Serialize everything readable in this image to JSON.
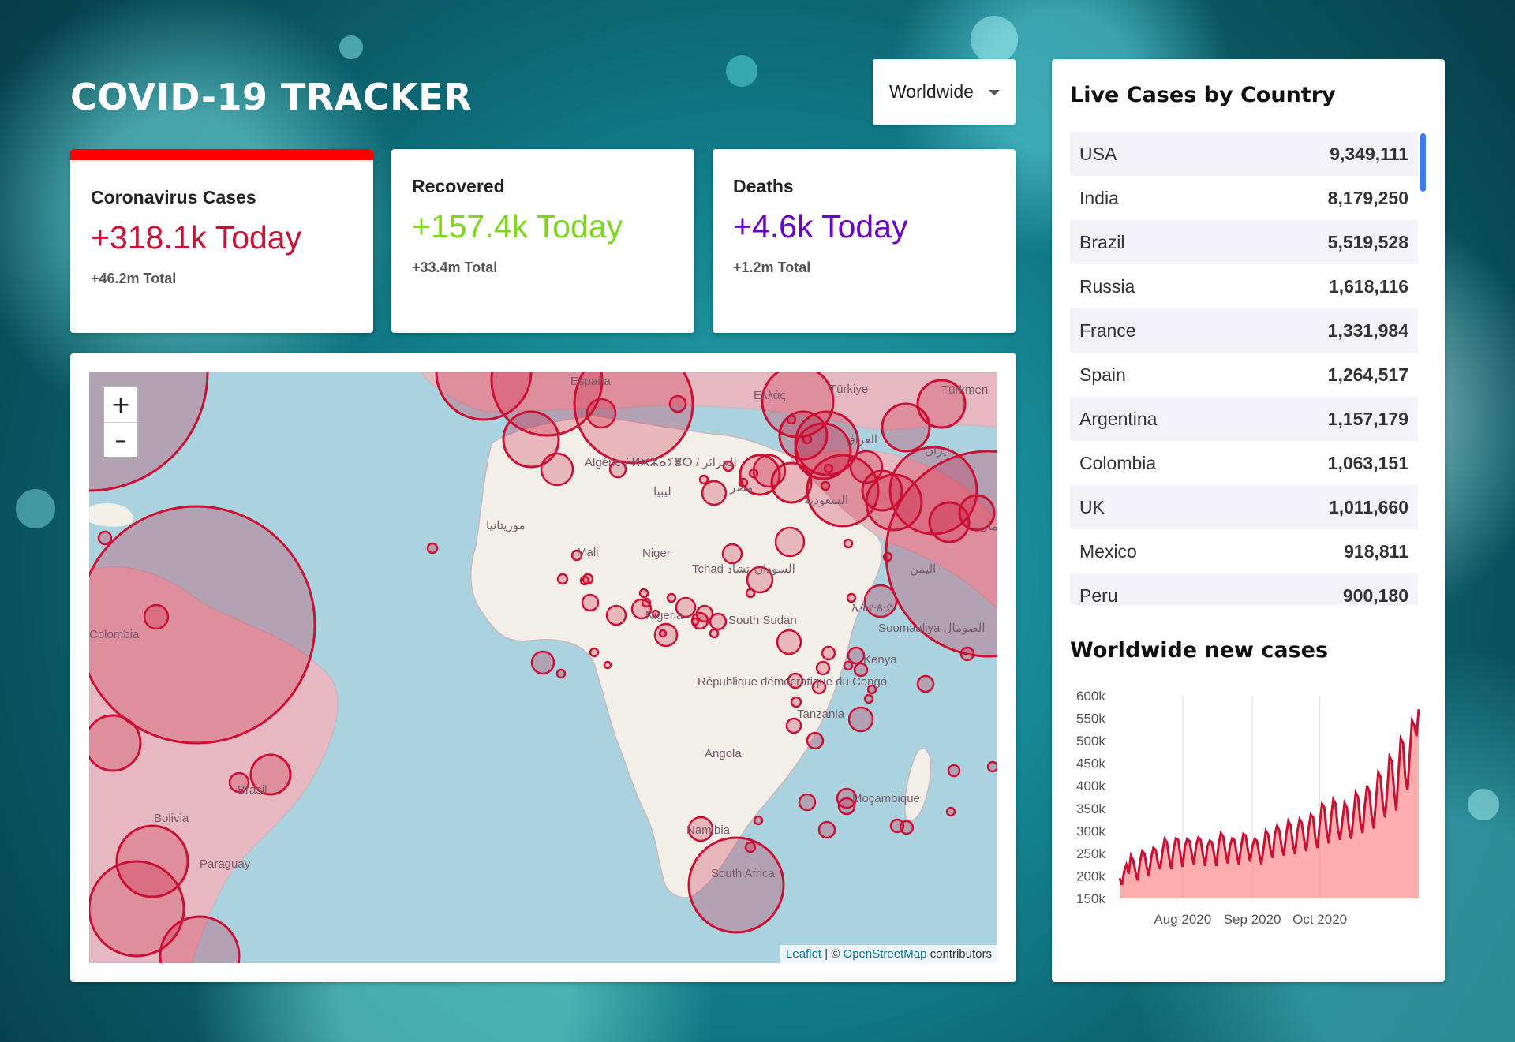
{
  "header": {
    "title": "COVID-19 TRACKER"
  },
  "region_select": {
    "value": "Worldwide"
  },
  "stats": {
    "cases": {
      "title": "Coronavirus Cases",
      "today": "+318.1k Today",
      "total": "+46.2m Total",
      "color": "#cc1034"
    },
    "recovered": {
      "title": "Recovered",
      "today": "+157.4k Today",
      "total": "+33.4m Total",
      "color": "#7dd71d"
    },
    "deaths": {
      "title": "Deaths",
      "today": "+4.6k Today",
      "total": "+1.2m Total",
      "color": "#6a00cc"
    }
  },
  "map": {
    "zoom_in": "+",
    "zoom_out": "–",
    "attribution": {
      "leaflet": "Leaflet",
      "separator": " | © ",
      "osm": "OpenStreetMap",
      "suffix": " contributors"
    },
    "labels": [
      "España",
      "Türkiye",
      "Türkmen",
      "Algérie / ⵍⵣⵣⴰⵢⴻⵔ / الجزائر",
      "ليبيا",
      "مصر",
      "العراق",
      "ايران",
      "السعودية",
      "عمان",
      "موريتانيا",
      "Mali",
      "Niger",
      "Tchad تشاد",
      "السودان",
      "اليمن",
      "Nigeria",
      "South Sudan",
      "ኢትዮጵያ",
      "Soomaaliya الصومال",
      "Kenya",
      "République démocratique du Congo",
      "Tanzania",
      "Angola",
      "Moçambique",
      "Namibia",
      "South Africa",
      "Colombia",
      "Brasil",
      "Bolivia",
      "Paraguay",
      "Ελλάς"
    ],
    "circle_color": "#cc1034"
  },
  "sidebar": {
    "table_title": "Live Cases by Country",
    "countries": [
      {
        "name": "USA",
        "cases": "9,349,111"
      },
      {
        "name": "India",
        "cases": "8,179,250"
      },
      {
        "name": "Brazil",
        "cases": "5,519,528"
      },
      {
        "name": "Russia",
        "cases": "1,618,116"
      },
      {
        "name": "France",
        "cases": "1,331,984"
      },
      {
        "name": "Spain",
        "cases": "1,264,517"
      },
      {
        "name": "Argentina",
        "cases": "1,157,179"
      },
      {
        "name": "Colombia",
        "cases": "1,063,151"
      },
      {
        "name": "UK",
        "cases": "1,011,660"
      },
      {
        "name": "Mexico",
        "cases": "918,811"
      },
      {
        "name": "Peru",
        "cases": "900,180"
      }
    ],
    "chart_title": "Worldwide new cases"
  },
  "chart_data": {
    "type": "area",
    "title": "Worldwide new cases",
    "xlabel": "",
    "ylabel": "",
    "ylim": [
      150000,
      600000
    ],
    "y_ticks": [
      "600k",
      "550k",
      "500k",
      "450k",
      "400k",
      "350k",
      "300k",
      "250k",
      "200k",
      "150k"
    ],
    "x_ticks": [
      "Aug 2020",
      "Sep 2020",
      "Oct 2020"
    ],
    "x_tick_day_index": [
      28,
      59,
      89
    ],
    "line_color": "#cc1034",
    "fill_color": "rgba(255,120,120,0.6)",
    "grid": "vertical",
    "values": [
      195000,
      180000,
      210000,
      225000,
      205000,
      245000,
      235000,
      210000,
      190000,
      230000,
      255000,
      250000,
      220000,
      200000,
      240000,
      262000,
      258000,
      230000,
      215000,
      252000,
      282000,
      275000,
      240000,
      215000,
      260000,
      283000,
      280000,
      248000,
      220000,
      265000,
      282000,
      278000,
      250000,
      225000,
      268000,
      285000,
      280000,
      248000,
      222000,
      265000,
      278000,
      275000,
      248000,
      222000,
      270000,
      295000,
      288000,
      255000,
      228000,
      265000,
      283000,
      280000,
      250000,
      225000,
      265000,
      293000,
      290000,
      258000,
      232000,
      265000,
      282000,
      278000,
      250000,
      226000,
      262000,
      300000,
      292000,
      260000,
      240000,
      292000,
      312000,
      300000,
      265000,
      245000,
      290000,
      322000,
      312000,
      272000,
      248000,
      298000,
      326000,
      318000,
      280000,
      255000,
      305000,
      336000,
      330000,
      285000,
      262000,
      318000,
      360000,
      352000,
      300000,
      272000,
      330000,
      370000,
      360000,
      305000,
      280000,
      320000,
      362000,
      352000,
      305000,
      282000,
      335000,
      385000,
      375000,
      320000,
      295000,
      355000,
      400000,
      388000,
      335000,
      305000,
      370000,
      430000,
      420000,
      360000,
      330000,
      390000,
      465000,
      455000,
      390000,
      345000,
      430000,
      505000,
      495000,
      420000,
      390000,
      470000,
      545000,
      535000,
      510000,
      570000
    ]
  }
}
